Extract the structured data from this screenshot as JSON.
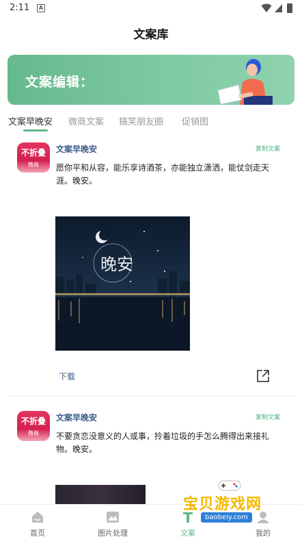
{
  "status": {
    "time": "2:11",
    "notif_glyph": "A"
  },
  "header": {
    "title": "文案库"
  },
  "banner": {
    "label": "文案编辑："
  },
  "tabs": [
    {
      "label": "文案早晚安",
      "active": true
    },
    {
      "label": "微商文案",
      "active": false
    },
    {
      "label": "搞笑朋友圈",
      "active": false
    },
    {
      "label": "促销图",
      "active": false
    }
  ],
  "posts": [
    {
      "avatar_top": "不折叠",
      "avatar_bottom": "微商",
      "author": "文案早晚安",
      "copy_label": "复制文案",
      "text": "愿你平和从容，能乐享诗酒茶，亦能独立潇洒，能仗剑走天涯。晚安。",
      "image_text": "晚安",
      "download_label": "下载"
    },
    {
      "avatar_top": "不折叠",
      "avatar_bottom": "微商",
      "author": "文案早晚安",
      "copy_label": "复制文案",
      "text": "不要贪恋没意义的人或事，拎着垃圾的手怎么腾得出来接礼物。晚安。"
    }
  ],
  "bottom_nav": [
    {
      "label": "首页",
      "icon": "home-icon"
    },
    {
      "label": "图片处理",
      "icon": "image-icon"
    },
    {
      "label": "文案",
      "icon": "text-icon",
      "active": true
    },
    {
      "label": "我的",
      "icon": "user-icon"
    }
  ],
  "watermark": {
    "text": "宝贝游戏网",
    "url": "baobeiy.com"
  },
  "colors": {
    "accent": "#5fb98a",
    "author": "#3d5a8a",
    "banner": "#7fcaa0"
  }
}
